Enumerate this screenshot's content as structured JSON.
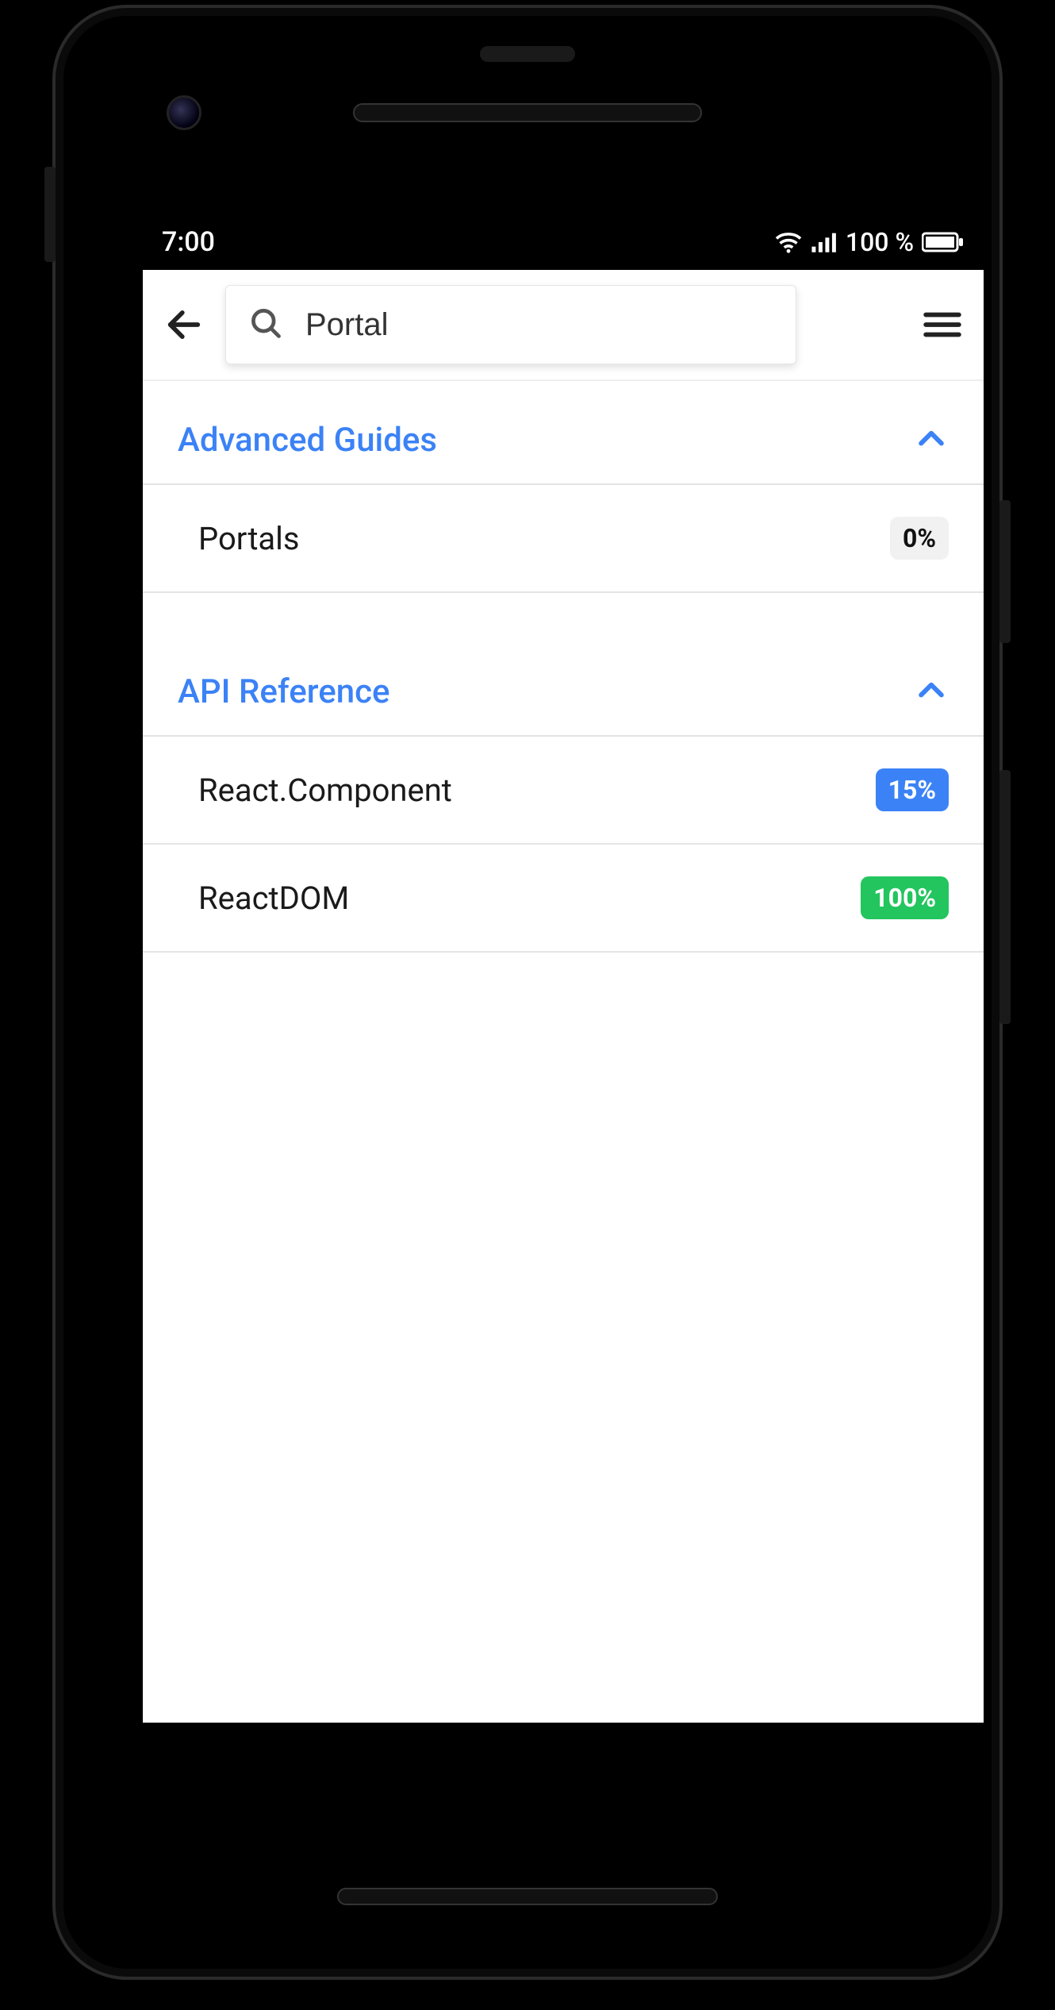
{
  "status": {
    "time": "7:00",
    "battery_text": "100 %"
  },
  "search": {
    "value": "Portal"
  },
  "sections": [
    {
      "title": "Advanced Guides",
      "items": [
        {
          "label": "Portals",
          "percent": "0%",
          "badge_color": "gray"
        }
      ]
    },
    {
      "title": "API Reference",
      "items": [
        {
          "label": "React.Component",
          "percent": "15%",
          "badge_color": "blue"
        },
        {
          "label": "ReactDOM",
          "percent": "100%",
          "badge_color": "green"
        }
      ]
    }
  ]
}
